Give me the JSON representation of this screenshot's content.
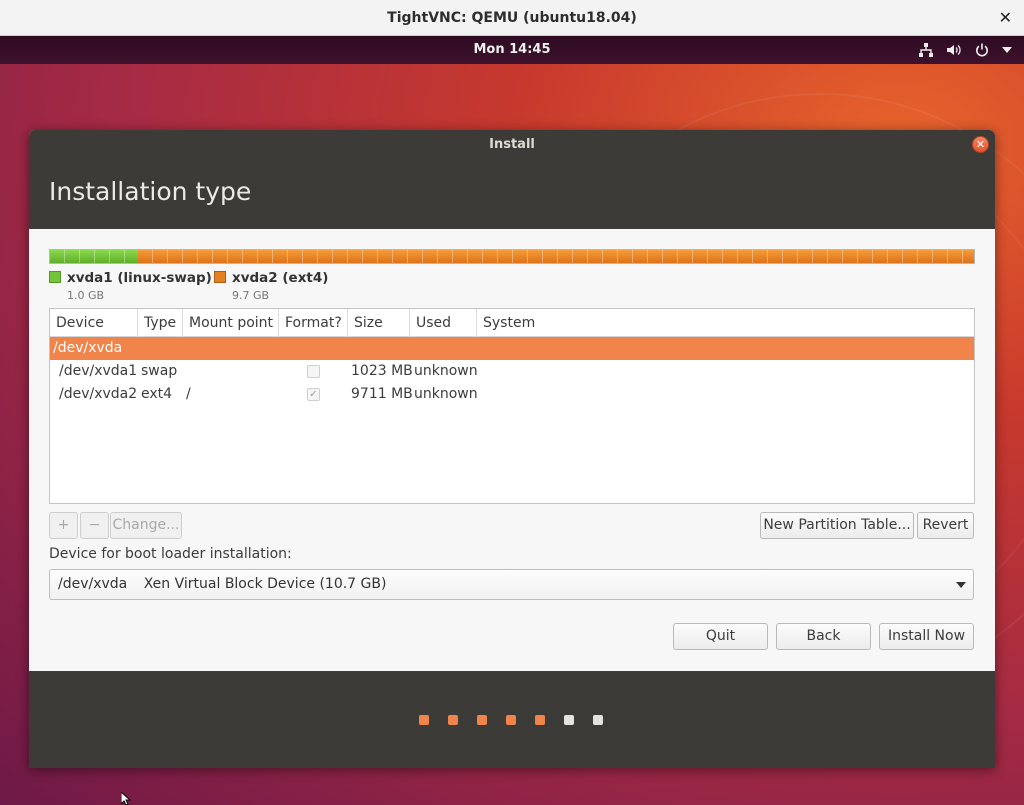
{
  "vnc_window": {
    "title": "TightVNC: QEMU (ubuntu18.04)",
    "close": "✕"
  },
  "topbar": {
    "clock": "Mon 14:45",
    "icons": [
      "network-icon",
      "volume-icon",
      "power-icon",
      "menu-arrow-icon"
    ]
  },
  "dialog": {
    "title": "Install",
    "close": "✕",
    "heading": "Installation type",
    "partition_bar": {
      "segments": [
        {
          "name": "xvda1 (linux-swap)",
          "size": "1.0 GB",
          "color": "#73c639"
        },
        {
          "name": "xvda2 (ext4)",
          "size": "9.7 GB",
          "color": "#e67e22"
        }
      ]
    },
    "table": {
      "columns": [
        "Device",
        "Type",
        "Mount point",
        "Format?",
        "Size",
        "Used",
        "System"
      ],
      "rows": [
        {
          "device": "/dev/xvda",
          "type": "",
          "mount": "",
          "format": null,
          "size": "",
          "used": "",
          "system": "",
          "selected": true
        },
        {
          "device": "/dev/xvda1",
          "type": "swap",
          "mount": "",
          "format": false,
          "size": "1023 MB",
          "used": "unknown",
          "system": ""
        },
        {
          "device": "/dev/xvda2",
          "type": "ext4",
          "mount": "/",
          "format": true,
          "size": "9711 MB",
          "used": "unknown",
          "system": ""
        }
      ]
    },
    "buttons": {
      "add": "+",
      "remove": "−",
      "change": "Change...",
      "new_partition_table": "New Partition Table...",
      "revert": "Revert",
      "quit": "Quit",
      "back": "Back",
      "install_now": "Install Now"
    },
    "boot_loader": {
      "label": "Device for boot loader installation:",
      "selected_device": "/dev/xvda",
      "selected_description": "Xen Virtual Block Device (10.7 GB)"
    },
    "progress": {
      "total_steps": 7,
      "completed_steps": 5
    }
  },
  "colors": {
    "accent": "#f0844a",
    "dialog_dark": "#3c3b37"
  }
}
